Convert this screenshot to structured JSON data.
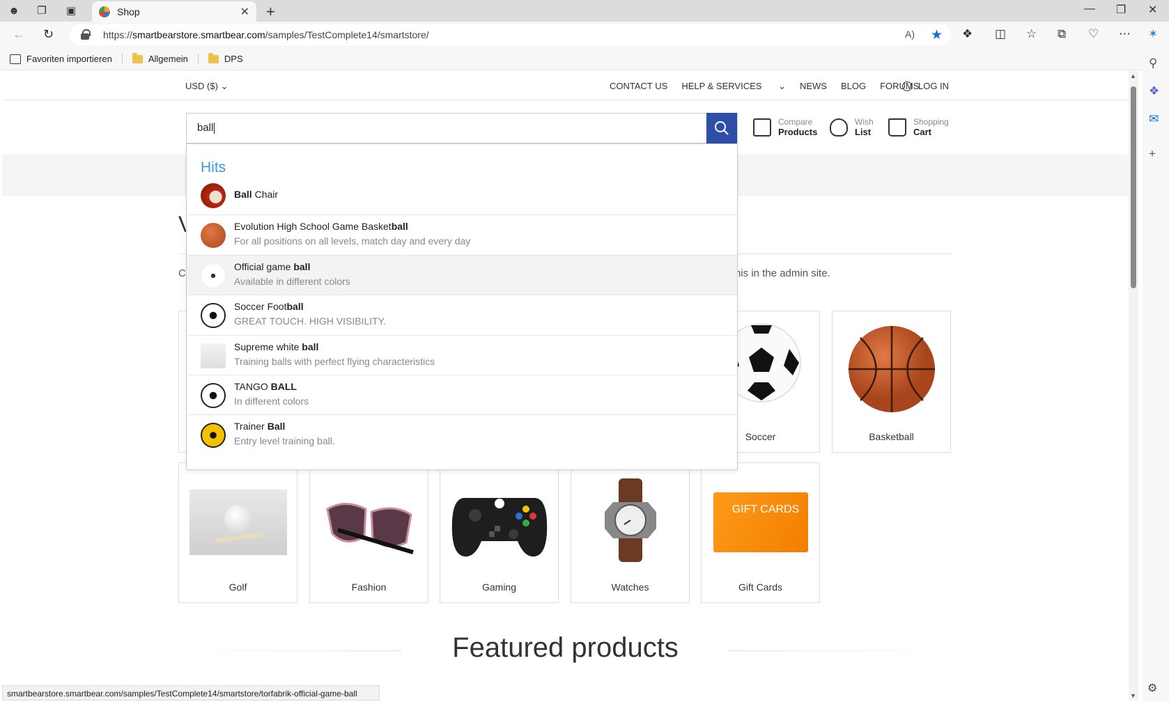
{
  "browser": {
    "tab_title": "Shop",
    "url_prefix": "https://",
    "url_host": "smartbearstore.smartbear.com",
    "url_path": "/samples/TestComplete14/smartstore/",
    "bookmarks": [
      "Favoriten importieren",
      "Allgemein",
      "DPS"
    ],
    "status_url": "smartbearstore.smartbear.com/samples/TestComplete14/smartstore/torfabrik-official-game-ball"
  },
  "site": {
    "currency": "USD  ($)",
    "nav": [
      "CONTACT US",
      "HELP & SERVICES",
      "NEWS",
      "BLOG",
      "FORUMS"
    ],
    "login": "LOG IN",
    "search_value": "ball",
    "header_icons": [
      {
        "top": "Compare",
        "bottom": "Products"
      },
      {
        "top": "Wish",
        "bottom": "List"
      },
      {
        "top": "Shopping",
        "bottom": "Cart"
      }
    ],
    "welcome_partial": "V",
    "admin_partial_left": "C",
    "admin_partial_right": "his in the admin site.",
    "featured_title": "Featured products"
  },
  "dropdown": {
    "section_title": "Hits",
    "items": [
      {
        "pre": "",
        "bold": "Ball",
        "post": " Chair",
        "desc": ""
      },
      {
        "pre": "Evolution High School Game Basket",
        "bold": "ball",
        "post": "",
        "desc": "For all positions on all levels, match day and every day"
      },
      {
        "pre": "Official game ",
        "bold": "ball",
        "post": "",
        "desc": "Available in different colors"
      },
      {
        "pre": "Soccer Foot",
        "bold": "ball",
        "post": "",
        "desc": "GREAT TOUCH. HIGH VISIBILITY."
      },
      {
        "pre": "Supreme white ",
        "bold": "ball",
        "post": "",
        "desc": "Training balls with perfect flying characteristics"
      },
      {
        "pre": "TANGO ",
        "bold": "BALL",
        "post": "",
        "desc": "In different colors"
      },
      {
        "pre": "Trainer ",
        "bold": "Ball",
        "post": "",
        "desc": "Entry level training ball."
      }
    ]
  },
  "categories": {
    "row1": [
      "Soccer",
      "Basketball"
    ],
    "row2": [
      "Golf",
      "Fashion",
      "Gaming",
      "Watches",
      "Gift Cards"
    ],
    "giftcard_text": "GIFT CARDS"
  },
  "colors": {
    "accent": "#2d4fa8",
    "hits": "#3d96d8",
    "star": "#1a6fd8"
  }
}
